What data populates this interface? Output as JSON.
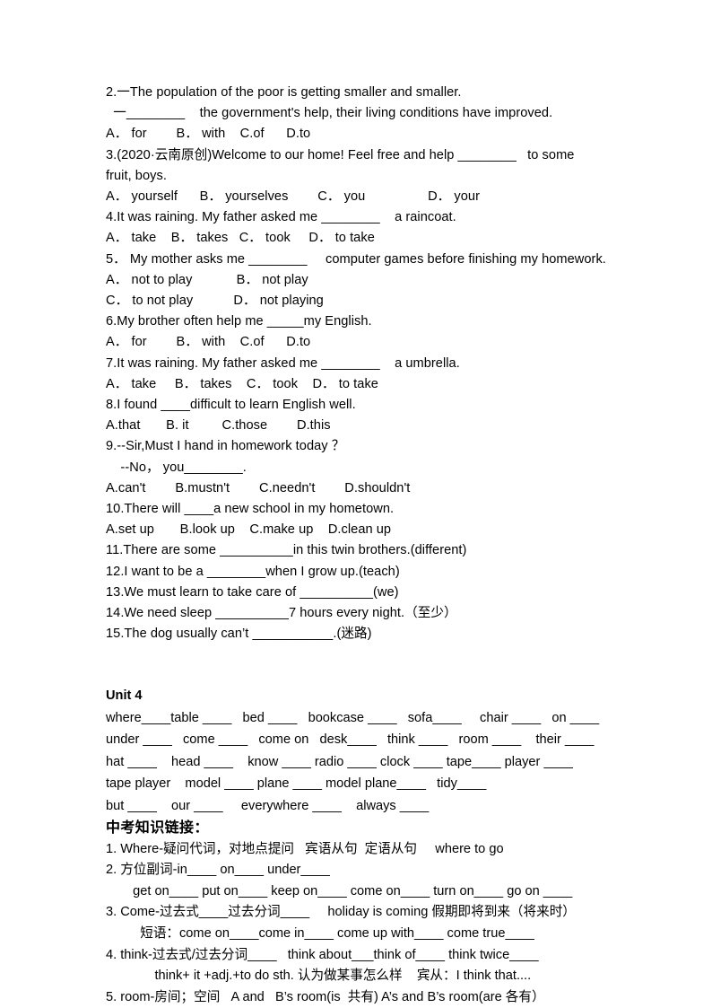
{
  "document": {
    "page_background": "#ffffff",
    "text_color": "#000000"
  },
  "questions": [
    {
      "id": "q2",
      "stem_line1": "2.一The population of the poor is getting smaller and smaller.",
      "stem_line2": "  一________    the government's help, their living conditions have improved.",
      "options": "A． for        B． with    C.of      D.to"
    },
    {
      "id": "q3",
      "stem_line1": "3.(2020·云南原创)Welcome to our home! Feel free and help ________   to some",
      "stem_line2": "fruit, boys.",
      "options": "A． yourself      B． yourselves        C． you                 D． your"
    },
    {
      "id": "q4",
      "stem_line1": "4.It was raining. My father asked me ________    a raincoat.",
      "options": "A． take    B． takes   C． took     D． to take"
    },
    {
      "id": "q5",
      "stem_line1": "5． My mother asks me ________     computer games before finishing my homework.",
      "options_line1": "A． not to play            B． not play",
      "options_line2": "C． to not play           D． not playing"
    },
    {
      "id": "q6",
      "stem_line1": "6.My brother often help me _____my English.",
      "options": "A． for        B． with    C.of      D.to"
    },
    {
      "id": "q7",
      "stem_line1": "7.It was raining. My father asked me ________    a umbrella.",
      "options": "A． take     B． takes    C． took    D． to take"
    },
    {
      "id": "q8",
      "stem_line1": "8.I found ____difficult to learn English well.",
      "options": "A.that       B. it         C.those        D.this"
    },
    {
      "id": "q9",
      "stem_line1": "9.--Sir,Must I hand in homework today ？",
      "stem_line2": "    --No， you________.",
      "options": "A.can't        B.mustn't        C.needn't        D.shouldn't"
    },
    {
      "id": "q10",
      "stem_line1": "10.There will ____a new school in my hometown.",
      "options": "A.set up       B.look up    C.make up    D.clean up"
    },
    {
      "id": "q11",
      "stem_line1": "11.There are some __________in this twin brothers.(different)"
    },
    {
      "id": "q12",
      "stem_line1": "12.I want to be a ________when I grow up.(teach)"
    },
    {
      "id": "q13",
      "stem_line1": "13.We must learn to take care of __________(we)"
    },
    {
      "id": "q14",
      "stem_line1": "14.We need sleep __________7 hours every night.（至少）"
    },
    {
      "id": "q15",
      "stem_line1": "15.The dog usually can’t ___________.(迷路)"
    }
  ],
  "unit4": {
    "heading": "Unit 4",
    "vocab_lines": [
      "where____table ____   bed ____   bookcase ____   sofa____     chair ____   on ____",
      "under ____   come ____   come on   desk____   think ____   room ____    their ____",
      "hat ____    head ____    know ____ radio ____ clock ____ tape____ player ____",
      "tape player    model ____ plane ____ model plane____   tidy____",
      "but ____    our ____     everywhere ____    always ____"
    ]
  },
  "knowledge_link": {
    "heading": "中考知识链接：",
    "items": [
      {
        "main": "1. Where-疑问代词，对地点提问   宾语从句  定语从句     where to go"
      },
      {
        "main": "2. 方位副词-in____ on____ under____",
        "sub": "  get on____ put on____ keep on____ come on____ turn on____ go on ____"
      },
      {
        "main": "3. Come-过去式____过去分词____     holiday is coming 假期即将到来（将来时）",
        "sub": "    短语：come on____come in____ come up with____ come true____"
      },
      {
        "main": "4. think-过去式/过去分词____   think about___think of____ think twice____",
        "sub": "        think+ it +adj.+to do sth. 认为做某事怎么样    宾从：I think that...."
      },
      {
        "main": "5. room-房间；空间   A and   B’s room(is  共有) A’s and B’s room(are 各有）"
      }
    ]
  }
}
